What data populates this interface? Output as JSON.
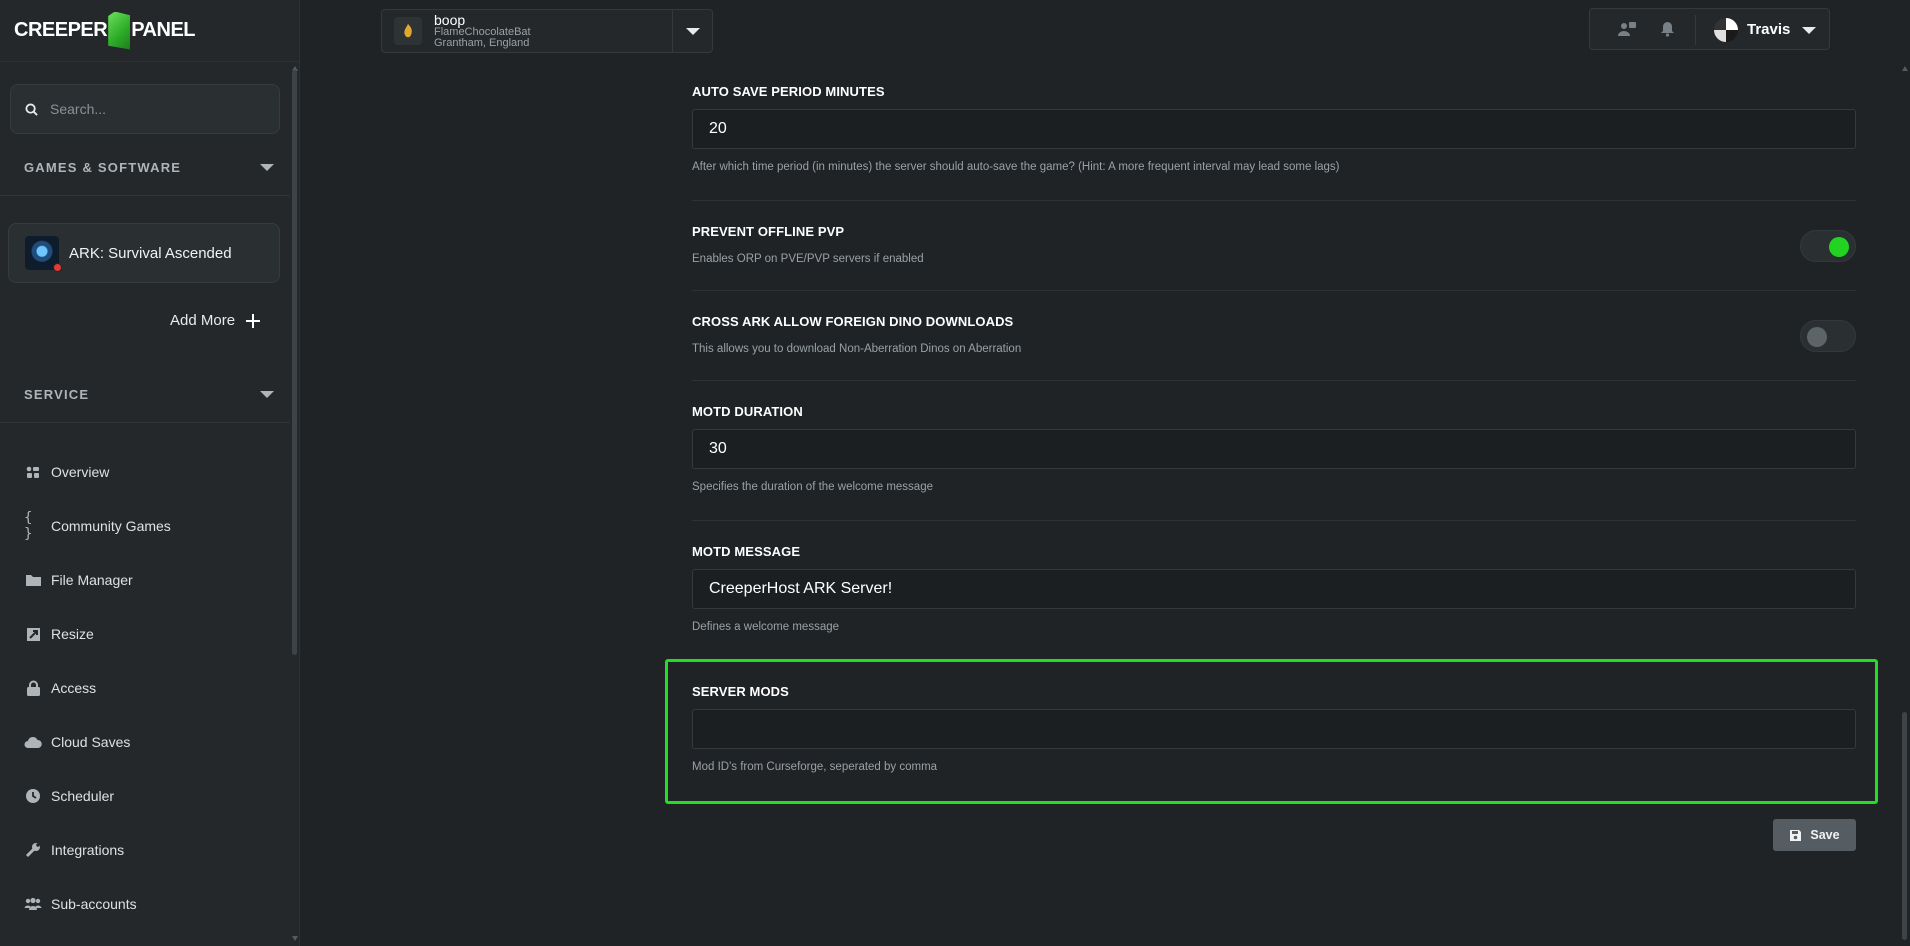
{
  "brand": {
    "left": "CREEPER",
    "right": "PANEL"
  },
  "sidebar": {
    "search_placeholder": "Search...",
    "games_heading": "GAMES & SOFTWARE",
    "game_name": "ARK: Survival Ascended",
    "add_more": "Add More",
    "service_heading": "SERVICE",
    "nav": [
      {
        "label": "Overview",
        "icon": "grid-icon"
      },
      {
        "label": "Community Games",
        "icon": "braces-icon"
      },
      {
        "label": "File Manager",
        "icon": "folder-icon"
      },
      {
        "label": "Resize",
        "icon": "resize-icon"
      },
      {
        "label": "Access",
        "icon": "lock-icon"
      },
      {
        "label": "Cloud Saves",
        "icon": "cloud-icon"
      },
      {
        "label": "Scheduler",
        "icon": "clock-icon"
      },
      {
        "label": "Integrations",
        "icon": "wrench-icon"
      },
      {
        "label": "Sub-accounts",
        "icon": "users-icon"
      }
    ]
  },
  "topbar": {
    "server_name": "boop",
    "server_host": "FlameChocolateBat",
    "server_location": "Grantham, England",
    "user_name": "Travis"
  },
  "settings": {
    "auto_save": {
      "label": "AUTO SAVE PERIOD MINUTES",
      "value": "20",
      "help": "After which time period (in minutes) the server should auto-save the game? (Hint: A more frequent interval may lead some lags)"
    },
    "prevent_pvp": {
      "label": "PREVENT OFFLINE PVP",
      "help": "Enables ORP on PVE/PVP servers if enabled",
      "enabled": true
    },
    "cross_ark": {
      "label": "CROSS ARK ALLOW FOREIGN DINO DOWNLOADS",
      "help": "This allows you to download Non-Aberration Dinos on Aberration",
      "enabled": false
    },
    "motd_duration": {
      "label": "MOTD DURATION",
      "value": "30",
      "help": "Specifies the duration of the welcome message"
    },
    "motd_message": {
      "label": "MOTD MESSAGE",
      "value": "CreeperHost ARK Server!",
      "help": "Defines a welcome message"
    },
    "server_mods": {
      "label": "SERVER MODS",
      "value": "",
      "help": "Mod ID's from Curseforge, seperated by comma"
    },
    "save_label": "Save"
  },
  "colors": {
    "accent": "#22dd22",
    "background": "#1f2326",
    "sidebar": "#24282b"
  }
}
